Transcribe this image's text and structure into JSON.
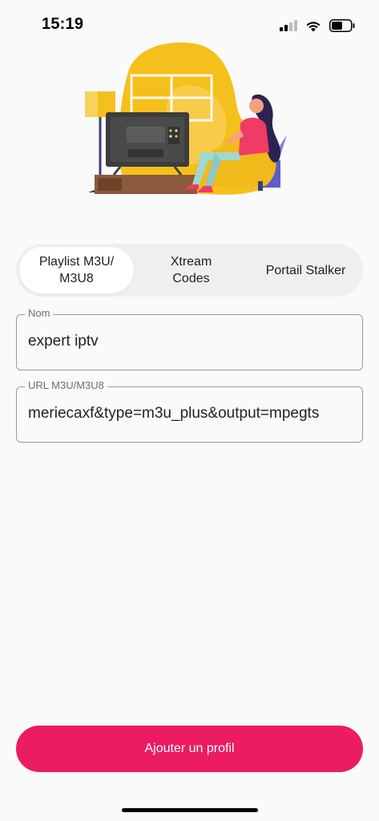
{
  "status_bar": {
    "time": "15:19"
  },
  "tabs": [
    {
      "label": "Playlist M3U/\nM3U8",
      "active": true
    },
    {
      "label": "Xtream\nCodes",
      "active": false
    },
    {
      "label": "Portail Stalker",
      "active": false
    }
  ],
  "form": {
    "name": {
      "label": "Nom",
      "value": "expert iptv"
    },
    "url": {
      "label": "URL M3U/M3U8",
      "value": "meriecaxf&type=m3u_plus&output=mpegts"
    }
  },
  "actions": {
    "submit_label": "Ajouter un profil"
  },
  "colors": {
    "accent": "#ec1c62",
    "background": "#fafafa",
    "segmented_bg": "#efefef",
    "illustration_yellow": "#f5bf1c"
  }
}
